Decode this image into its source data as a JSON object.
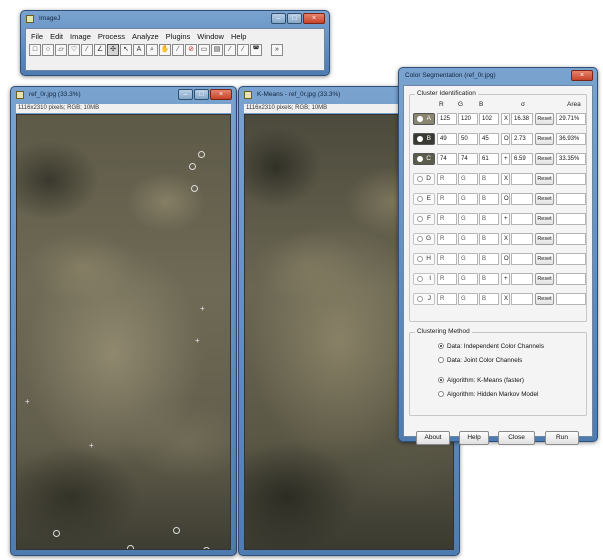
{
  "imagej": {
    "title": "ImageJ",
    "menu": [
      "File",
      "Edit",
      "Image",
      "Process",
      "Analyze",
      "Plugins",
      "Window",
      "Help"
    ],
    "tools": [
      {
        "name": "rectangle-tool-icon",
        "glyph": "□"
      },
      {
        "name": "oval-tool-icon",
        "glyph": "○"
      },
      {
        "name": "polygon-tool-icon",
        "glyph": "▱"
      },
      {
        "name": "freehand-tool-icon",
        "glyph": "♡"
      },
      {
        "name": "line-tool-icon",
        "glyph": "⁄"
      },
      {
        "name": "angle-tool-icon",
        "glyph": "∠"
      },
      {
        "name": "point-tool-icon",
        "glyph": "✣"
      },
      {
        "name": "wand-tool-icon",
        "glyph": "↖"
      },
      {
        "name": "text-tool-icon",
        "glyph": "A"
      },
      {
        "name": "magnifier-tool-icon",
        "glyph": "⌕"
      },
      {
        "name": "hand-tool-icon",
        "glyph": "✋"
      },
      {
        "name": "dropper-tool-icon",
        "glyph": "⁄"
      },
      {
        "name": "stop-tool-icon",
        "glyph": "⊘"
      },
      {
        "name": "lut-tool-icon",
        "glyph": "▭"
      },
      {
        "name": "stk-tool-icon",
        "glyph": "▤"
      },
      {
        "name": "pencil-tool-icon",
        "glyph": "⁄"
      },
      {
        "name": "brush-tool-icon",
        "glyph": "⁄"
      },
      {
        "name": "flood-tool-icon",
        "glyph": "◚"
      },
      {
        "name": "more-tools-icon",
        "glyph": "»"
      }
    ]
  },
  "window1": {
    "title": "ref_0r.jpg (33.3%)",
    "info": "1116x2310 pixels; RGB; 10MB"
  },
  "window2": {
    "title": "K-Means - ref_0r.jpg (33.3%)",
    "info": "1116x2310 pixels; RGB; 10MB"
  },
  "segmentation": {
    "title": "Color Segmentation (ref_0r.jpg)",
    "cluster_group_title": "Cluster Identification",
    "headers": {
      "r": "R",
      "g": "G",
      "b": "B",
      "sigma": "σ",
      "area": "Area"
    },
    "active_clusters": [
      {
        "letter": "A",
        "r": "125",
        "g": "120",
        "b": "102",
        "sym": "X",
        "sigma": "16.38",
        "btn": "Reset",
        "area": "29.71%",
        "color": "#8a8670"
      },
      {
        "letter": "B",
        "r": "49",
        "g": "50",
        "b": "45",
        "sym": "O",
        "sigma": "2.73",
        "btn": "Reset",
        "area": "36.93%",
        "color": "#3a3a34"
      },
      {
        "letter": "C",
        "r": "74",
        "g": "74",
        "b": "61",
        "sym": "+",
        "sigma": "6.59",
        "btn": "Reset",
        "area": "33.35%",
        "color": "#5c5c4c"
      }
    ],
    "empty_clusters": [
      {
        "letter": "D",
        "r": "R",
        "g": "G",
        "b": "B",
        "sym": "X",
        "btn": "Reset"
      },
      {
        "letter": "E",
        "r": "R",
        "g": "G",
        "b": "B",
        "sym": "O",
        "btn": "Reset"
      },
      {
        "letter": "F",
        "r": "R",
        "g": "G",
        "b": "B",
        "sym": "+",
        "btn": "Reset"
      },
      {
        "letter": "G",
        "r": "R",
        "g": "G",
        "b": "B",
        "sym": "X",
        "btn": "Reset"
      },
      {
        "letter": "H",
        "r": "R",
        "g": "G",
        "b": "B",
        "sym": "O",
        "btn": "Reset"
      },
      {
        "letter": "I",
        "r": "R",
        "g": "G",
        "b": "B",
        "sym": "+",
        "btn": "Reset"
      },
      {
        "letter": "J",
        "r": "R",
        "g": "G",
        "b": "B",
        "sym": "X",
        "btn": "Reset"
      }
    ],
    "method_group_title": "Clustering Method",
    "data_options": [
      {
        "label": "Data: Independent Color Channels",
        "selected": true
      },
      {
        "label": "Data: Joint Color Channels",
        "selected": false
      }
    ],
    "algorithm_options": [
      {
        "label": "Algorithm: K-Means (faster)",
        "selected": true
      },
      {
        "label": "Algorithm: Hidden Markov Model",
        "selected": false
      }
    ],
    "buttons": {
      "about": "About",
      "help": "Help",
      "close": "Close",
      "run": "Run"
    }
  },
  "colors": {
    "titlebar": "#6a94c4",
    "close_button": "#c6432a"
  }
}
